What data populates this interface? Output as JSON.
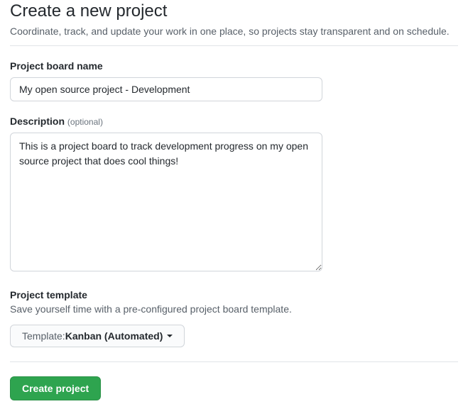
{
  "header": {
    "title": "Create a new project",
    "subtitle": "Coordinate, track, and update your work in one place, so projects stay transparent and on schedule."
  },
  "boardName": {
    "label": "Project board name",
    "value": "My open source project - Development"
  },
  "description": {
    "label": "Description",
    "optional": "(optional)",
    "value": "This is a project board to track development progress on my open source project that does cool things!"
  },
  "template": {
    "label": "Project template",
    "desc": "Save yourself time with a pre-configured project board template.",
    "prefix": "Template: ",
    "selected": "Kanban (Automated)"
  },
  "submit": {
    "label": "Create project"
  }
}
